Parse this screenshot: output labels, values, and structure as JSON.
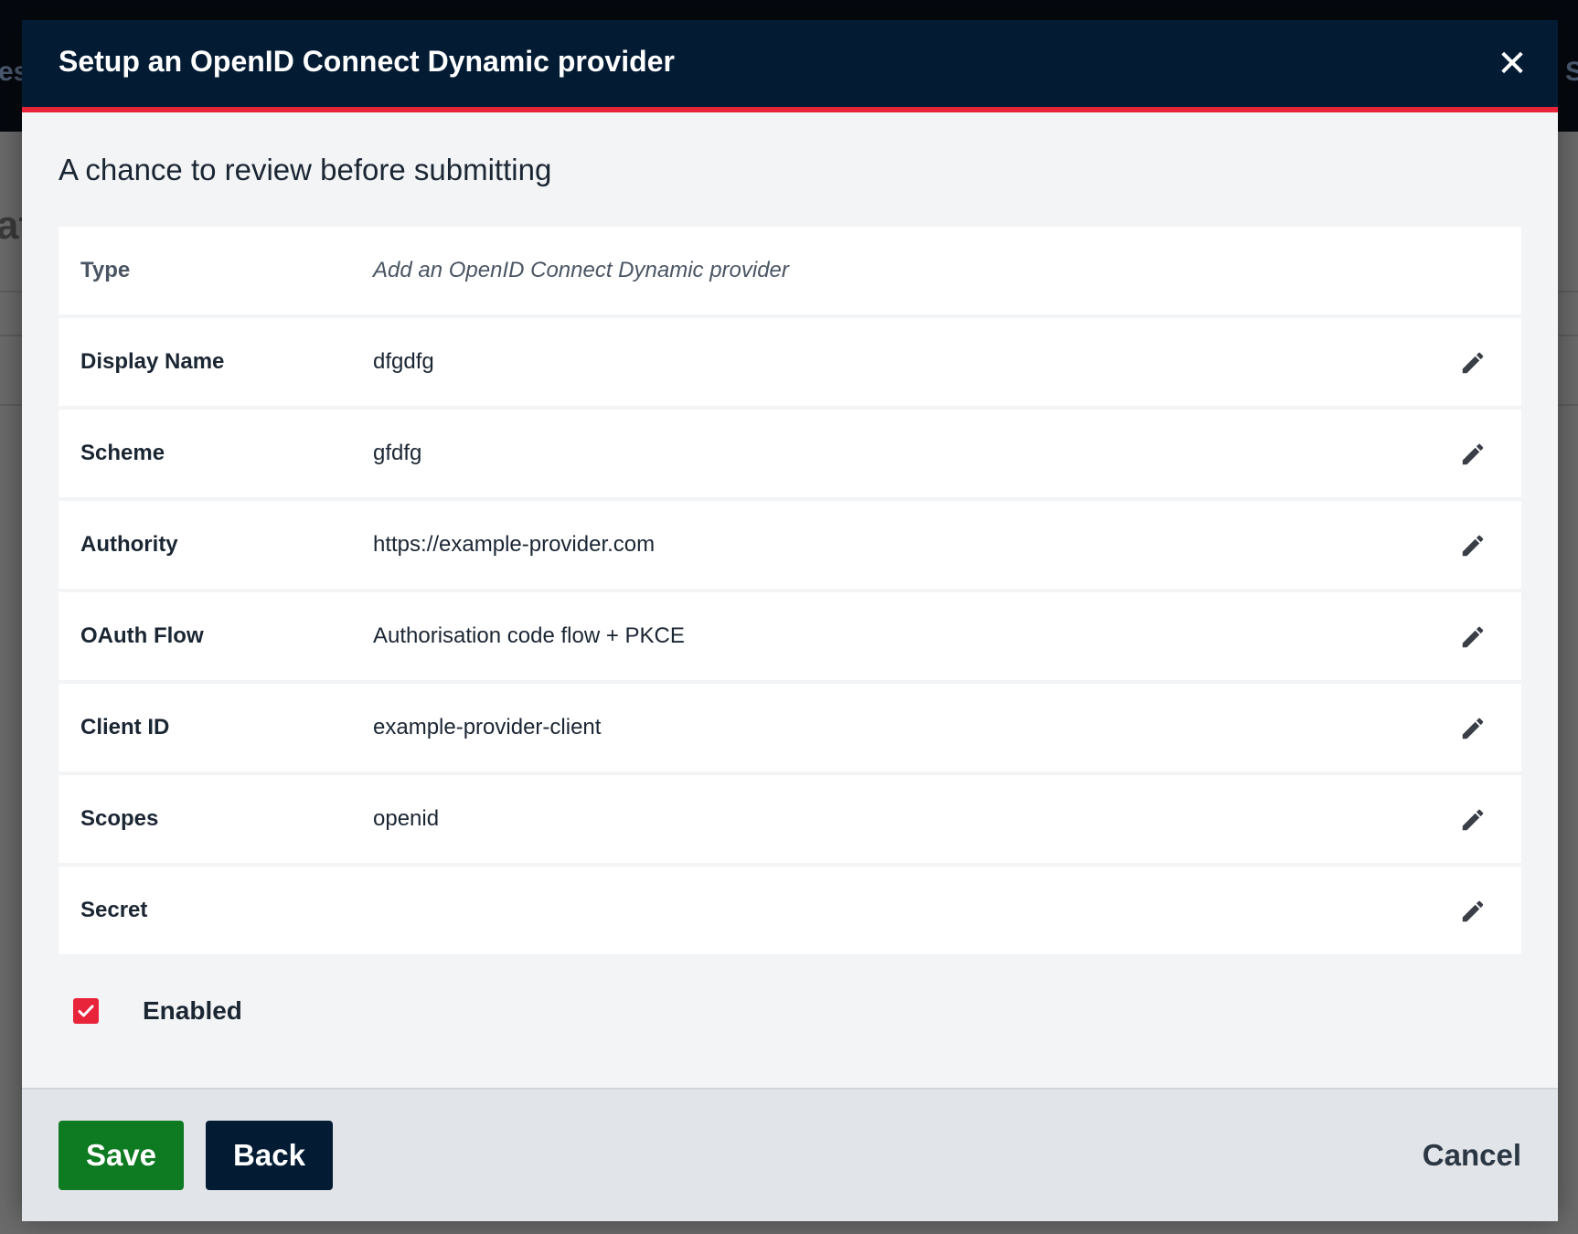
{
  "background": {
    "left_fragments": [
      "es",
      "at"
    ],
    "right_fragment": "S"
  },
  "modal": {
    "title": "Setup an OpenID Connect Dynamic provider",
    "close_icon": "close-icon",
    "subtitle": "A chance to review before submitting",
    "rows": [
      {
        "label": "Type",
        "value": "Add an OpenID Connect Dynamic provider",
        "editable": false
      },
      {
        "label": "Display Name",
        "value": "dfgdfg",
        "editable": true
      },
      {
        "label": "Scheme",
        "value": "gfdfg",
        "editable": true
      },
      {
        "label": "Authority",
        "value": "https://example-provider.com",
        "editable": true
      },
      {
        "label": "OAuth Flow",
        "value": "Authorisation code flow + PKCE",
        "editable": true
      },
      {
        "label": "Client ID",
        "value": "example-provider-client",
        "editable": true
      },
      {
        "label": "Scopes",
        "value": "openid",
        "editable": true
      },
      {
        "label": "Secret",
        "value": "",
        "editable": true
      }
    ],
    "enabled": {
      "label": "Enabled",
      "checked": true
    },
    "footer": {
      "save_label": "Save",
      "back_label": "Back",
      "cancel_label": "Cancel"
    }
  },
  "colors": {
    "header_bg": "#031c34",
    "accent_red": "#e8243a",
    "save_green": "#0e7a21"
  }
}
